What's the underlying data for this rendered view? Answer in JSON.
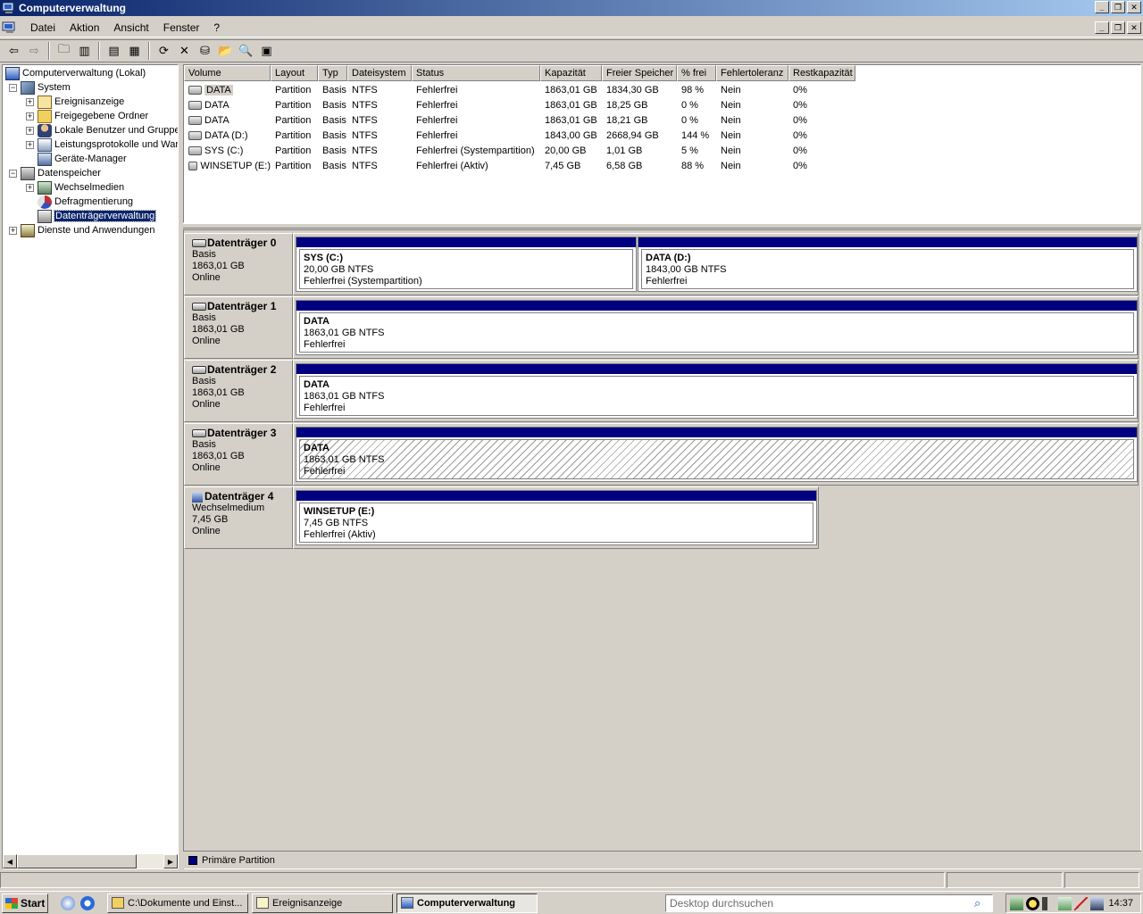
{
  "window": {
    "title": "Computerverwaltung"
  },
  "menu": [
    "Datei",
    "Aktion",
    "Ansicht",
    "Fenster",
    "?"
  ],
  "tree": {
    "root": "Computerverwaltung (Lokal)",
    "items": [
      {
        "label": "System"
      },
      {
        "label": "Ereignisanzeige"
      },
      {
        "label": "Freigegebene Ordner"
      },
      {
        "label": "Lokale Benutzer und Gruppe"
      },
      {
        "label": "Leistungsprotokolle und War"
      },
      {
        "label": "Geräte-Manager"
      },
      {
        "label": "Datenspeicher"
      },
      {
        "label": "Wechselmedien"
      },
      {
        "label": "Defragmentierung"
      },
      {
        "label": "Datenträgerverwaltung"
      },
      {
        "label": "Dienste und Anwendungen"
      }
    ]
  },
  "list": {
    "columns": [
      "Volume",
      "Layout",
      "Typ",
      "Dateisystem",
      "Status",
      "Kapazität",
      "Freier Speicher",
      "% frei",
      "Fehlertoleranz",
      "Restkapazität"
    ],
    "rows": [
      [
        "DATA",
        "Partition",
        "Basis",
        "NTFS",
        "Fehlerfrei",
        "1863,01 GB",
        "1834,30 GB",
        "98 %",
        "Nein",
        "0%"
      ],
      [
        "DATA",
        "Partition",
        "Basis",
        "NTFS",
        "Fehlerfrei",
        "1863,01 GB",
        "18,25 GB",
        "0 %",
        "Nein",
        "0%"
      ],
      [
        "DATA",
        "Partition",
        "Basis",
        "NTFS",
        "Fehlerfrei",
        "1863,01 GB",
        "18,21 GB",
        "0 %",
        "Nein",
        "0%"
      ],
      [
        "DATA (D:)",
        "Partition",
        "Basis",
        "NTFS",
        "Fehlerfrei",
        "1843,00 GB",
        "2668,94 GB",
        "144 %",
        "Nein",
        "0%"
      ],
      [
        "SYS (C:)",
        "Partition",
        "Basis",
        "NTFS",
        "Fehlerfrei (Systempartition)",
        "20,00 GB",
        "1,01 GB",
        "5 %",
        "Nein",
        "0%"
      ],
      [
        "WINSETUP (E:)",
        "Partition",
        "Basis",
        "NTFS",
        "Fehlerfrei (Aktiv)",
        "7,45 GB",
        "6,58 GB",
        "88 %",
        "Nein",
        "0%"
      ]
    ]
  },
  "disks": [
    {
      "name": "Datenträger 0",
      "type": "Basis",
      "size": "1863,01 GB",
      "state": "Online",
      "partitions": [
        {
          "name": "SYS  (C:)",
          "size": "20,00 GB NTFS",
          "status": "Fehlerfrei (Systempartition)"
        },
        {
          "name": "DATA  (D:)",
          "size": "1843,00 GB NTFS",
          "status": "Fehlerfrei"
        }
      ]
    },
    {
      "name": "Datenträger 1",
      "type": "Basis",
      "size": "1863,01 GB",
      "state": "Online",
      "partitions": [
        {
          "name": "DATA",
          "size": "1863,01 GB NTFS",
          "status": "Fehlerfrei"
        }
      ]
    },
    {
      "name": "Datenträger 2",
      "type": "Basis",
      "size": "1863,01 GB",
      "state": "Online",
      "partitions": [
        {
          "name": "DATA",
          "size": "1863,01 GB NTFS",
          "status": "Fehlerfrei"
        }
      ]
    },
    {
      "name": "Datenträger 3",
      "type": "Basis",
      "size": "1863,01 GB",
      "state": "Online",
      "partitions": [
        {
          "name": "DATA",
          "size": "1863,01 GB NTFS",
          "status": "Fehlerfrei"
        }
      ]
    },
    {
      "name": "Datenträger 4",
      "type": "Wechselmedium",
      "size": "7,45 GB",
      "state": "Online",
      "partitions": [
        {
          "name": "WINSETUP  (E:)",
          "size": "7,45 GB NTFS",
          "status": "Fehlerfrei (Aktiv)"
        }
      ]
    }
  ],
  "legend": {
    "label": "Primäre Partition",
    "color": "#000080"
  },
  "taskbar": {
    "start": "Start",
    "buttons": [
      "C:\\Dokumente und Einst...",
      "Ereignisanzeige",
      "Computerverwaltung"
    ],
    "search_placeholder": "Desktop durchsuchen",
    "clock": "14:37"
  }
}
